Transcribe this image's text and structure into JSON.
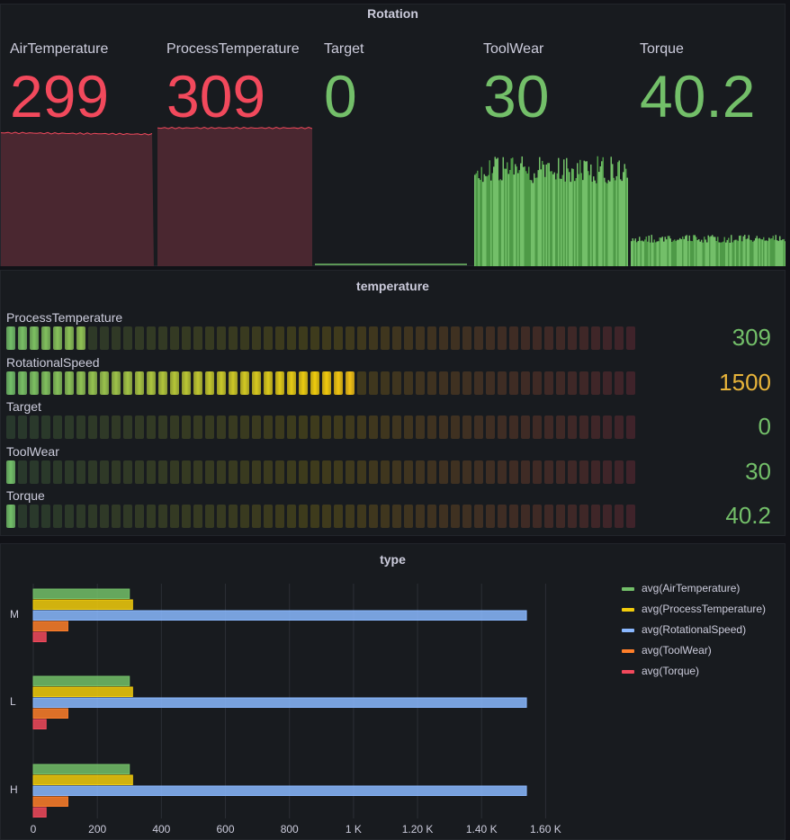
{
  "rotation_panel": {
    "title": "Rotation",
    "stats": [
      {
        "name": "AirTemperature",
        "value": "299",
        "color": "#f2495c",
        "fill": "#4a2730",
        "level": 0.56
      },
      {
        "name": "ProcessTemperature",
        "value": "309",
        "color": "#f2495c",
        "fill": "#4a2730",
        "level": 0.58
      },
      {
        "name": "Target",
        "value": "0",
        "color": "#73bf69",
        "fill": "#73bf69",
        "level": 0.0
      },
      {
        "name": "ToolWear",
        "value": "30",
        "color": "#73bf69",
        "fill": "#56a64b",
        "level": 0.42
      },
      {
        "name": "Torque",
        "value": "40.2",
        "color": "#73bf69",
        "fill": "#56a64b",
        "level": 0.12
      }
    ]
  },
  "temperature_panel": {
    "title": "temperature",
    "rows": [
      {
        "name": "ProcessTemperature",
        "value": "309",
        "color": "#73bf69",
        "fraction": 0.125
      },
      {
        "name": "RotationalSpeed",
        "value": "1500",
        "color": "#f2cc0c",
        "fraction": 0.56
      },
      {
        "name": "Target",
        "value": "0",
        "color": "#73bf69",
        "fraction": 0.0
      },
      {
        "name": "ToolWear",
        "value": "30",
        "color": "#73bf69",
        "fraction": 0.02
      },
      {
        "name": "Torque",
        "value": "40.2",
        "color": "#73bf69",
        "fraction": 0.02
      }
    ]
  },
  "type_panel": {
    "title": "type",
    "chart_data": {
      "type": "bar",
      "orientation": "horizontal",
      "categories": [
        "M",
        "L",
        "H"
      ],
      "series": [
        {
          "name": "avg(AirTemperature)",
          "color": "#73bf69",
          "values": [
            300,
            300,
            300
          ]
        },
        {
          "name": "avg(ProcessTemperature)",
          "color": "#f2cc0c",
          "values": [
            310,
            310,
            310
          ]
        },
        {
          "name": "avg(RotationalSpeed)",
          "color": "#8ab8ff",
          "values": [
            1540,
            1540,
            1540
          ]
        },
        {
          "name": "avg(ToolWear)",
          "color": "#ff7f2a",
          "values": [
            108,
            108,
            108
          ]
        },
        {
          "name": "avg(Torque)",
          "color": "#f2495c",
          "values": [
            40,
            40,
            40
          ]
        }
      ],
      "xlim": [
        0,
        1700
      ],
      "xticks": [
        0,
        200,
        400,
        600,
        800,
        1000,
        1200,
        1400,
        1600
      ],
      "xtick_labels": [
        "0",
        "200",
        "400",
        "600",
        "800",
        "1 K",
        "1.20 K",
        "1.40 K",
        "1.60 K"
      ],
      "grid": true,
      "legend": "top-right"
    }
  }
}
